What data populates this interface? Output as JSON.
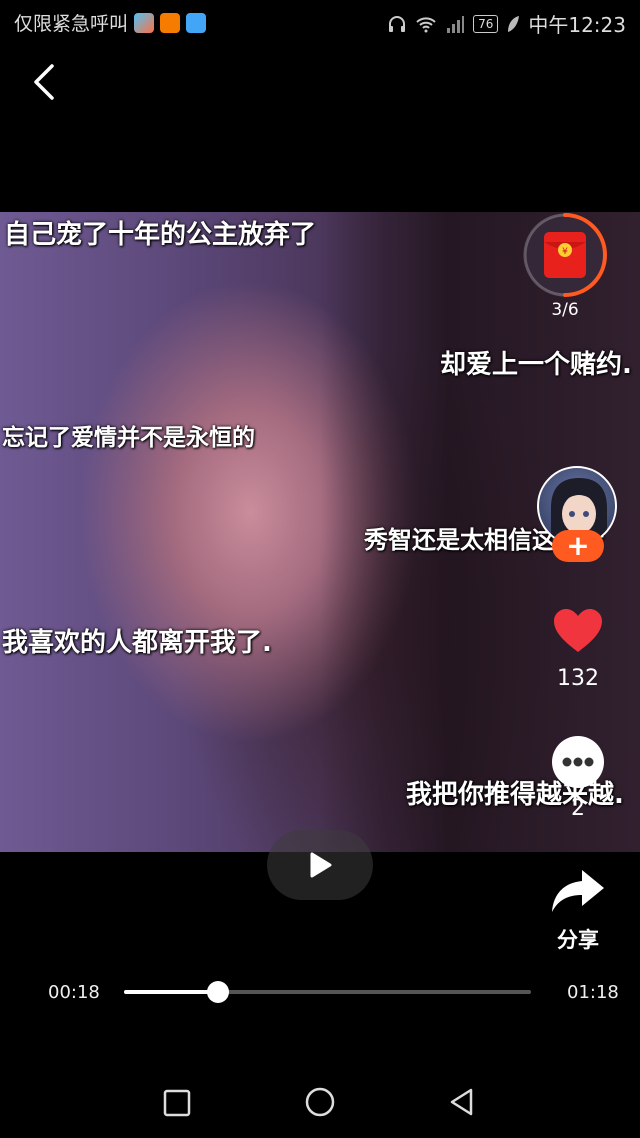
{
  "status_bar": {
    "carrier_text": "仅限紧急呼叫",
    "battery": "76",
    "time": "中午12:23"
  },
  "icons": {
    "back": "chevron-left-icon",
    "red_packet": "red-envelope-icon",
    "like": "heart-icon",
    "comment": "ellipsis-icon",
    "share": "share-arrow-icon",
    "play": "play-icon"
  },
  "captions": [
    "自己宠了十年的公主放弃了",
    "却爱上一个赌约.",
    "忘记了爱情并不是永恒的",
    "秀智还是太相信这爱情",
    "我喜欢的人都离开我了.",
    "我把你推得越来越."
  ],
  "red_packet": {
    "progress": "3/6",
    "progress_fraction": 0.5
  },
  "follow": {
    "label": "+"
  },
  "likes": {
    "count": "132"
  },
  "comments": {
    "count": "2"
  },
  "share": {
    "label": "分享"
  },
  "player": {
    "current_time": "00:18",
    "total_time": "01:18",
    "progress_fraction": 0.23
  },
  "colors": {
    "accent": "#ff5a1f",
    "like": "#f0353f",
    "red_packet": "#e8211c"
  }
}
